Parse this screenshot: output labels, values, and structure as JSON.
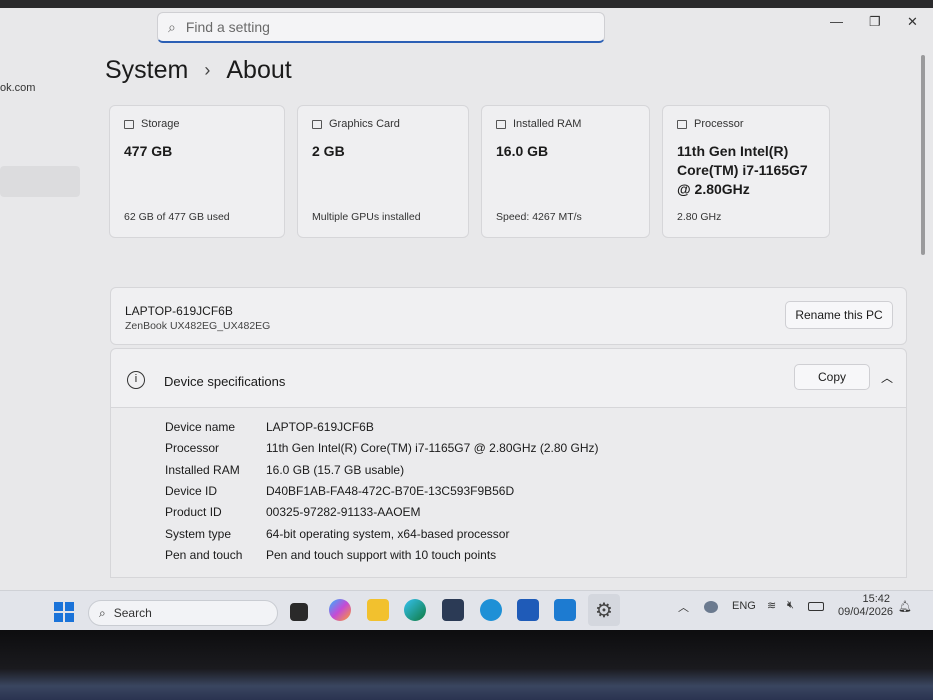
{
  "search": {
    "placeholder": "Find a setting"
  },
  "window": {
    "minimize": "—",
    "restore": "❐",
    "close": "✕"
  },
  "sidebar": {
    "account_fragment": "ok.com"
  },
  "breadcrumb": {
    "parent": "System",
    "separator": "›",
    "current": "About"
  },
  "cards": [
    {
      "icon": "storage-icon",
      "label": "Storage",
      "value": "477 GB",
      "sub": "62 GB of 477 GB used"
    },
    {
      "icon": "graphics-card-icon",
      "label": "Graphics Card",
      "value": "2 GB",
      "sub": "Multiple GPUs installed"
    },
    {
      "icon": "ram-icon",
      "label": "Installed RAM",
      "value": "16.0 GB",
      "sub": "Speed: 4267 MT/s"
    },
    {
      "icon": "processor-icon",
      "label": "Processor",
      "value": "11th Gen Intel(R) Core(TM) i7-1165G7 @ 2.80GHz",
      "sub": "2.80 GHz"
    }
  ],
  "device": {
    "name": "LAPTOP-619JCF6B",
    "model": "ZenBook UX482EG_UX482EG",
    "rename_label": "Rename this PC"
  },
  "specs": {
    "title": "Device specifications",
    "copy_label": "Copy",
    "rows": [
      {
        "k": "Device name",
        "v": "LAPTOP-619JCF6B"
      },
      {
        "k": "Processor",
        "v": "11th Gen Intel(R) Core(TM) i7-1165G7 @ 2.80GHz (2.80 GHz)"
      },
      {
        "k": "Installed RAM",
        "v": "16.0 GB (15.7 GB usable)"
      },
      {
        "k": "Device ID",
        "v": "D40BF1AB-FA48-472C-B70E-13C593F9B56D"
      },
      {
        "k": "Product ID",
        "v": "00325-97282-91133-AAOEM"
      },
      {
        "k": "System type",
        "v": "64-bit operating system, x64-based processor"
      },
      {
        "k": "Pen and touch",
        "v": "Pen and touch support with 10 touch points"
      }
    ]
  },
  "taskbar": {
    "search_label": "Search",
    "language": "ENG",
    "time": "15:42",
    "date": "09/04/2026"
  }
}
